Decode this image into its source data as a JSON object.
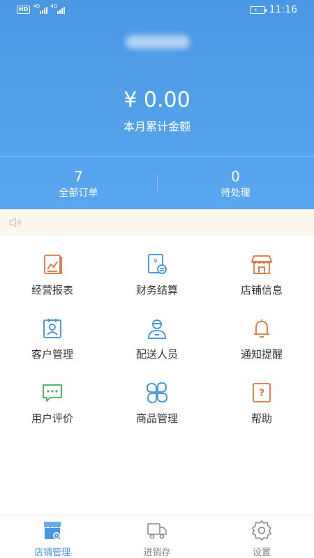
{
  "status_bar": {
    "hd": "HD",
    "network1": "4G",
    "network2": "4G",
    "time": "11:16"
  },
  "header": {
    "amount": "¥ 0.00",
    "amount_label": "本月累计金额",
    "stats": [
      {
        "value": "7",
        "label": "全部订单"
      },
      {
        "value": "0",
        "label": "待处理"
      }
    ]
  },
  "menu": {
    "items": [
      {
        "label": "经营报表",
        "icon": "report-chart-icon"
      },
      {
        "label": "财务结算",
        "icon": "finance-settlement-icon"
      },
      {
        "label": "店铺信息",
        "icon": "store-icon"
      },
      {
        "label": "客户管理",
        "icon": "customer-card-icon"
      },
      {
        "label": "配送人员",
        "icon": "delivery-person-icon"
      },
      {
        "label": "通知提醒",
        "icon": "bell-icon"
      },
      {
        "label": "用户评价",
        "icon": "chat-bubble-icon"
      },
      {
        "label": "商品管理",
        "icon": "petals-icon"
      },
      {
        "label": "帮助",
        "icon": "help-icon"
      }
    ]
  },
  "tabbar": {
    "items": [
      {
        "label": "店铺管理",
        "icon": "store-manage-icon",
        "active": true
      },
      {
        "label": "进销存",
        "icon": "truck-icon",
        "active": false
      },
      {
        "label": "设置",
        "icon": "gear-icon",
        "active": false
      }
    ]
  },
  "colors": {
    "primary": "#4a97e3",
    "orange": "#e0733f",
    "green": "#3dae5a",
    "blue": "#3b8fd8",
    "notice_bg": "#fdf8eb"
  }
}
